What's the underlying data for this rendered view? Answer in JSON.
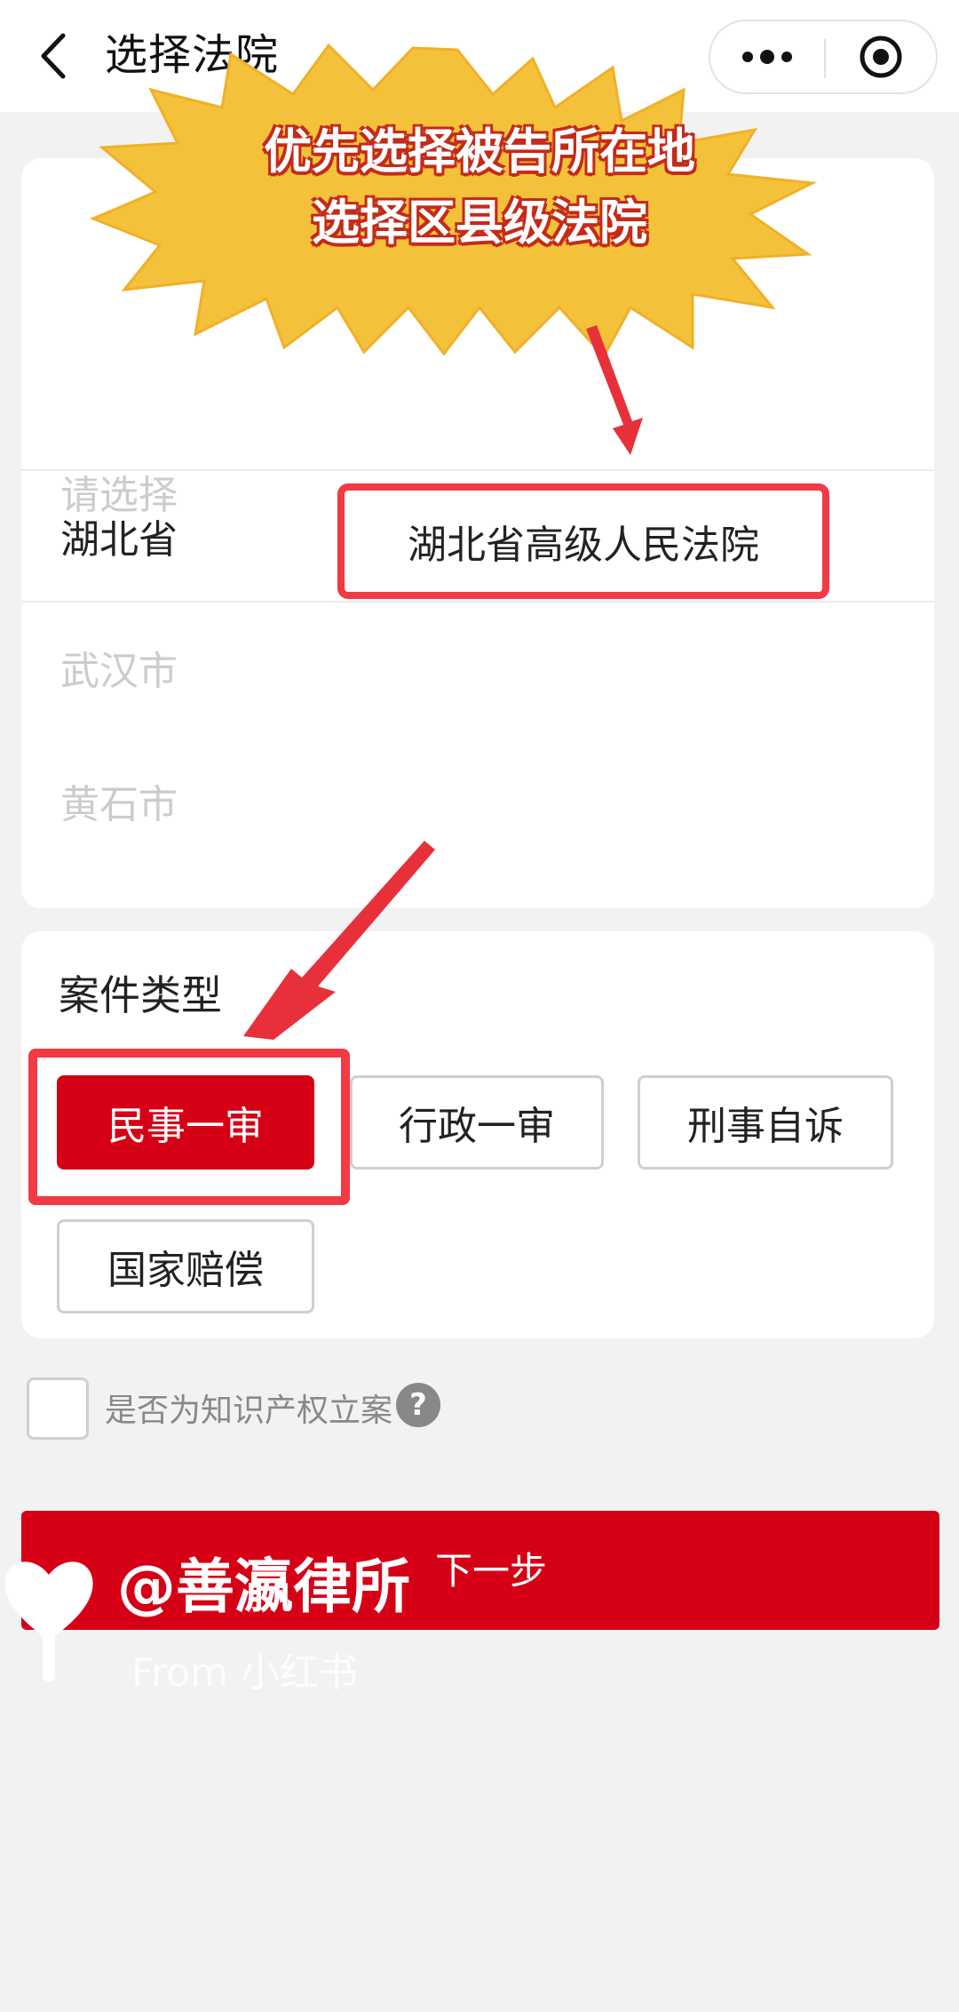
{
  "navbar": {
    "title": "选择法院",
    "back_icon": "chevron-left-icon",
    "more_icon": "more-dots-icon",
    "close_icon": "target-close-icon"
  },
  "annotation": {
    "line1": "优先选择被告所在地",
    "line2": "选择区县级法院",
    "burst_color": "#f4c23a",
    "highlight_color": "#f13a44"
  },
  "region": {
    "rows": [
      {
        "label": "请选择",
        "selected": false
      },
      {
        "label": "湖北省",
        "selected": true
      },
      {
        "label": "武汉市",
        "selected": false
      },
      {
        "label": "黄石市",
        "selected": false
      }
    ],
    "court_option": "湖北省高级人民法院"
  },
  "case": {
    "title": "案件类型",
    "types": [
      {
        "label": "民事一审",
        "active": true
      },
      {
        "label": "行政一审",
        "active": false
      },
      {
        "label": "刑事自诉",
        "active": false
      },
      {
        "label": "国家赔偿",
        "active": false
      }
    ],
    "active_color": "#d50016"
  },
  "ip": {
    "label": "是否为知识产权立案",
    "help_icon": "?"
  },
  "next": {
    "label": "下一步"
  },
  "watermark": {
    "handle": "@善瀛律所",
    "from": "From 小红书"
  }
}
